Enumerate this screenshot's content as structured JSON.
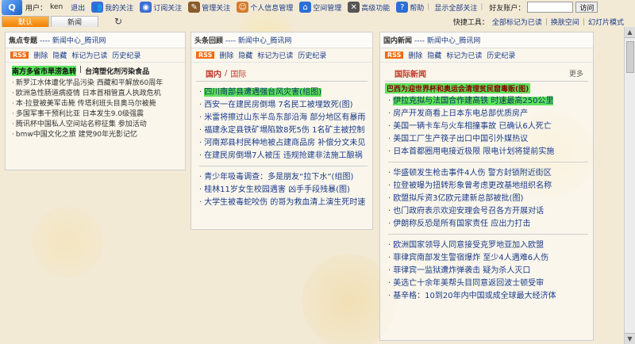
{
  "topbar": {
    "user_label": "用户：",
    "username": "ken",
    "logout": "退出",
    "items": [
      {
        "icon": "people-icon",
        "label": "我的关注",
        "color": "#3b6fd6"
      },
      {
        "icon": "rss-globe-icon",
        "label": "订阅关注",
        "color": "#3b6fd6"
      },
      {
        "icon": "settings-icon",
        "label": "管理关注",
        "color": "#8a5a2b"
      },
      {
        "icon": "person-icon",
        "label": "个人信息管理",
        "color": "#d67a2b"
      },
      {
        "icon": "home-icon",
        "label": "空间管理",
        "color": "#2b6fd6"
      },
      {
        "icon": "wrench-icon",
        "label": "高级功能",
        "color": "#555555"
      },
      {
        "icon": "help-icon",
        "label": "帮助",
        "color": "#2b6fd6"
      }
    ],
    "show_all": "显示全部关注",
    "friend_label": "好友账户：",
    "visit_button": "访问"
  },
  "tabs": [
    {
      "label": "默认",
      "active": true
    },
    {
      "label": "新闻",
      "active": false
    }
  ],
  "shortcuts": {
    "label": "快捷工具：",
    "links": [
      "全部标记为已读",
      "换肤空间",
      "幻灯片模式"
    ]
  },
  "panels": {
    "focus": {
      "title": "焦点专题",
      "source": "---- 新闻中心_腾讯网",
      "controls": [
        "删除",
        "隐藏",
        "标记为已读",
        "历史纪录"
      ],
      "highlight1": "南方多省市旱涝急转",
      "highlight_sep": "|",
      "highlight2": "台湾塑化剂污染食品",
      "items": [
        "新罗江水体遭化学品污染  西藏和平解放60周年",
        "欧洲急性肠道病疫情  日本首相管直人执政危机",
        "本·拉登被美军击毙  传塔利班头目奥马尔被毙",
        "多国军事干预利比亚  日本发生9.0级强震",
        "腾讯杯中国私人空间站名称征集  参加活动",
        "bmw中国文化之旅  建党90年光影记忆"
      ]
    },
    "headlines": {
      "title": "头条回顾",
      "source": "---- 新闻中心_腾讯网",
      "controls": [
        "删除",
        "隐藏",
        "标记为已读",
        "历史纪录"
      ],
      "section_a": "国内",
      "section_sep": "/",
      "section_b": "国际",
      "group1": [
        {
          "text": "四川南部县遭遇强台风灾害(组图)",
          "hl": true
        },
        {
          "text": "西安一在建民房倒塌  7名民工被埋致死(图)",
          "hl": false
        },
        {
          "text": "米雷将擦过山东半岛东部沿海  部分地区有暴雨",
          "hl": false
        },
        {
          "text": "福建永定县铁矿塌陷致8死5伤  1名矿主被控制",
          "hl": false
        },
        {
          "text": "河南郑县村民种地被占建商品房  补偿分文未见",
          "hl": false
        },
        {
          "text": "在建民房倒塌7人被压  违规抢建非法施工酿祸",
          "hl": false
        }
      ],
      "group2": [
        "青少年吸毒调查：多是朋友“拉下水”(组图)",
        "桂林11岁女生校园遇害  凶手手段残暴(图)",
        "大学生被毒蛇咬伤  的哥为救血清上演生死时速"
      ]
    },
    "domestic": {
      "title": "国内新闻",
      "source": "---- 新闻中心_腾讯网",
      "controls": [
        "删除",
        "隐藏",
        "标记为已读",
        "历史纪录"
      ],
      "section": "国际新闻",
      "more": "更多",
      "sub_highlight": "巴西为迎世界杯和奥运会清理贫民窟毒贩(图)",
      "group1": [
        {
          "text": "伊拉克拟与法国合作建高铁  时速最高250公里",
          "hl": true
        },
        {
          "text": "房产开发商看上日本东电总部优质房产",
          "hl": false
        },
        {
          "text": "美国一辆卡车与火车相撞事故  已确认6人死亡",
          "hl": false
        },
        {
          "text": "美国工厂生产筷子出口中国引外媒热议",
          "hl": false
        },
        {
          "text": "日本首都圈用电接近极限  限电计划将提前实施",
          "hl": false
        }
      ],
      "group2": [
        "华盛顿发生枪击事件4人伤  警方封锁附近街区",
        "拉登被曝为扭转形象曾考虑更改基地组织名称",
        "欧盟拟斥资3亿欧元建新总部被批(图)",
        "也门政府表示欢迎安理会号召各方开展对话",
        "伊朗称反恐是所有国家责任  应出力打击"
      ],
      "group3": [
        "欧洲国家领导人同意接受克罗地亚加入欧盟",
        "菲律宾南部发生警宿爆炸  至少4人遇难6人伤",
        "菲律宾一监狱遭炸弹袭击  疑为杀人灭口",
        "美选亡十余年美帮头目同意返回波士顿受审",
        "基辛格：10到20年内中国或成全球最大经济体"
      ]
    }
  }
}
